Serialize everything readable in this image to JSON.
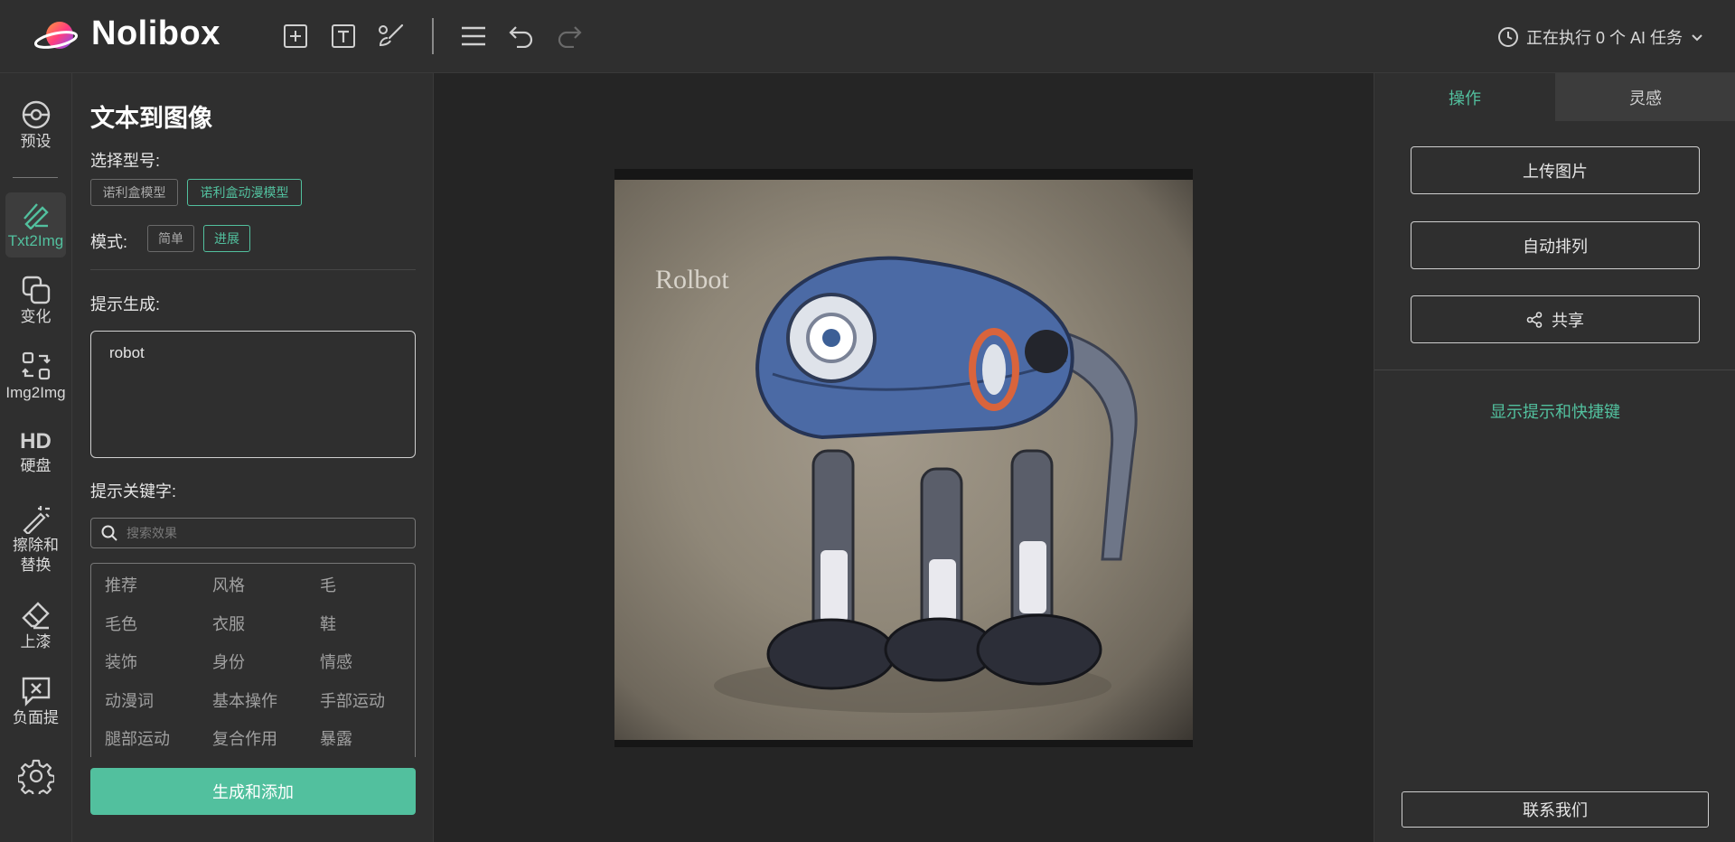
{
  "app": {
    "brand": "Nolibox"
  },
  "toolbar": {
    "tools": [
      {
        "icon": "plus-square-icon",
        "name": "add-frame"
      },
      {
        "icon": "text-box-icon",
        "name": "add-text"
      },
      {
        "icon": "brush-icon",
        "name": "draw-brush"
      },
      {
        "icon": "menu-icon",
        "name": "menu"
      },
      {
        "icon": "undo-icon",
        "name": "undo"
      },
      {
        "icon": "redo-icon",
        "name": "redo"
      }
    ],
    "ai_status": "正在执行 0 个 AI 任务"
  },
  "rail": {
    "items": [
      {
        "label": "预设",
        "icon": "preset-icon"
      },
      {
        "label": "Txt2Img",
        "icon": "txt2img-icon"
      },
      {
        "label": "变化",
        "icon": "variation-icon"
      },
      {
        "label": "Img2Img",
        "icon": "img2img-icon"
      },
      {
        "label": "硬盘",
        "icon": "hd-icon",
        "glyph": "HD"
      },
      {
        "label": "擦除和替换",
        "icon": "magic-wand-icon"
      },
      {
        "label": "上漆",
        "icon": "eraser-icon"
      },
      {
        "label": "负面提",
        "icon": "negative-prompt-icon"
      },
      {
        "label": "",
        "icon": "settings-gear-icon"
      }
    ],
    "active_index": 1
  },
  "panel": {
    "title": "文本到图像",
    "model_label": "选择型号:",
    "models": [
      "诺利盒模型",
      "诺利盒动漫模型"
    ],
    "selected_model": "诺利盒动漫模型",
    "mode_label": "模式:",
    "modes": [
      "简单",
      "进展"
    ],
    "selected_mode": "进展",
    "prompt_label": "提示生成:",
    "prompt_value": "robot",
    "keywords_label": "提示关键字:",
    "search_placeholder": "搜索效果",
    "keywords": [
      [
        "推荐",
        "风格",
        "毛"
      ],
      [
        "毛色",
        "衣服",
        "鞋"
      ],
      [
        "装饰",
        "身份",
        "情感"
      ],
      [
        "动漫词",
        "基本操作",
        "手部运动"
      ],
      [
        "腿部运动",
        "复合作用",
        "暴露"
      ]
    ],
    "generate_button": "生成和添加"
  },
  "canvas": {
    "image_text": "Rolbot"
  },
  "right": {
    "tabs": [
      "操作",
      "灵感"
    ],
    "active_tab": "操作",
    "buttons": [
      "上传图片",
      "自动排列",
      "共享"
    ],
    "hint_link": "显示提示和快捷键",
    "contact_button": "联系我们"
  },
  "colors": {
    "accent": "#52c09e",
    "background": "#262626",
    "panel": "#2f2f2f"
  }
}
